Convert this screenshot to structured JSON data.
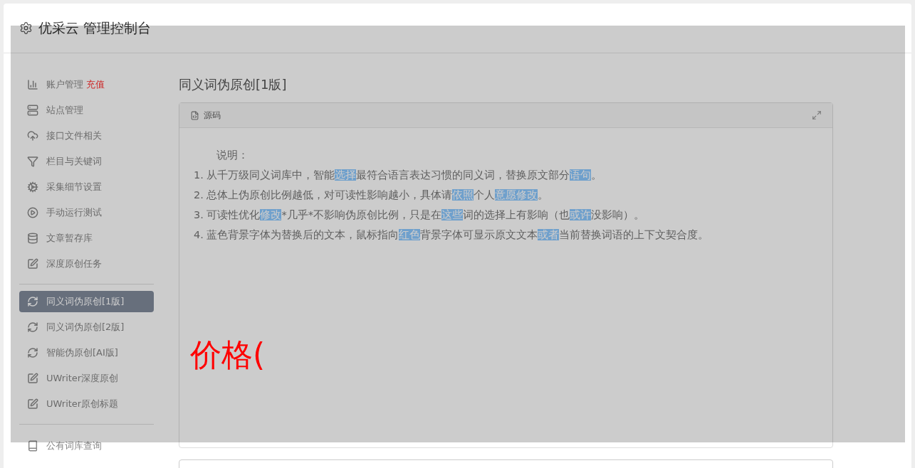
{
  "header": {
    "title": "优采云 管理控制台"
  },
  "sidebar": {
    "groups": [
      [
        {
          "label": "账户管理",
          "badge": "充值",
          "selected": false
        },
        {
          "label": "站点管理",
          "selected": false
        },
        {
          "label": "接口文件相关",
          "selected": false
        },
        {
          "label": "栏目与关键词",
          "selected": false
        },
        {
          "label": "采集细节设置",
          "selected": false
        },
        {
          "label": "手动运行测试",
          "selected": false
        },
        {
          "label": "文章暂存库",
          "selected": false
        },
        {
          "label": "深度原创任务",
          "selected": false
        }
      ],
      [
        {
          "label": "同义词伪原创[1版]",
          "selected": true
        },
        {
          "label": "同义词伪原创[2版]",
          "selected": false
        },
        {
          "label": "智能伪原创[AI版]",
          "selected": false
        },
        {
          "label": "UWriter深度原创",
          "selected": false
        },
        {
          "label": "UWriter原创标题",
          "selected": false
        }
      ],
      [
        {
          "label": "公有词库查询",
          "selected": false
        }
      ]
    ]
  },
  "main": {
    "title": "同义词伪原创[1版]",
    "editor": {
      "toolbar_label": "源码",
      "heading": "说明：",
      "lines": [
        [
          {
            "text": "1. 从千万级同义词库中，智能",
            "highlighted": false
          },
          {
            "text": "选择",
            "highlighted": true
          },
          {
            "text": "最符合语言表达习惯的同义词，替换原文部分",
            "highlighted": false
          },
          {
            "text": "语句",
            "highlighted": true
          },
          {
            "text": "。",
            "highlighted": false
          }
        ],
        [
          {
            "text": "2. 总体上伪原创比例越低，对可读性影响越小，具体请",
            "highlighted": false
          },
          {
            "text": "依照",
            "highlighted": true
          },
          {
            "text": "个人",
            "highlighted": false
          },
          {
            "text": "意愿",
            "highlighted": true
          },
          {
            "text": "修改",
            "highlighted": true
          },
          {
            "text": "。",
            "highlighted": false
          }
        ],
        [
          {
            "text": "3. 可读性优化",
            "highlighted": false
          },
          {
            "text": "修改",
            "highlighted": true
          },
          {
            "text": "*几乎*不影响伪原创比例，只是在",
            "highlighted": false
          },
          {
            "text": "这些",
            "highlighted": true
          },
          {
            "text": "词的选择上有影响（也",
            "highlighted": false
          },
          {
            "text": "或许",
            "highlighted": true
          },
          {
            "text": "没影响）。",
            "highlighted": false
          }
        ],
        [
          {
            "text": "4. 蓝色背景字体为替换后的文本，鼠标指向",
            "highlighted": false
          },
          {
            "text": "红色",
            "highlighted": true
          },
          {
            "text": "背景字体可显示原文文本",
            "highlighted": false
          },
          {
            "text": "或者",
            "highlighted": true
          },
          {
            "text": "当前替换词语的上下文契合度。",
            "highlighted": false
          }
        ]
      ]
    }
  },
  "overlay": {
    "text": "价格("
  }
}
